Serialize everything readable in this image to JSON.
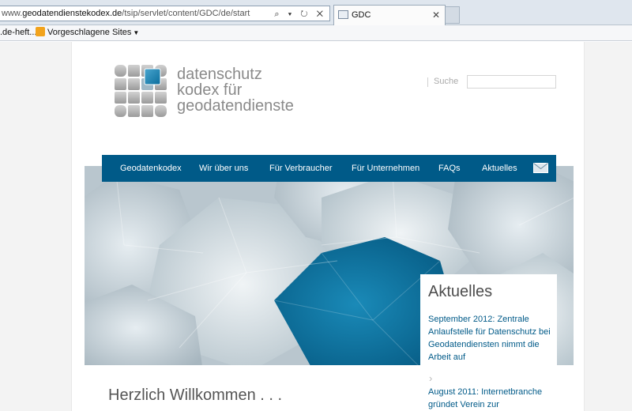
{
  "browser": {
    "url_prefix": "www.",
    "url_domain": "geodatendienstekodex.de",
    "url_path": "/tsip/servlet/content/GDC/de/start",
    "url_icons": "⌕ ▾ ↻ ✕",
    "tab_title": "GDC",
    "tab_close": "✕",
    "favorites": [
      {
        "label": ".de-heft..."
      },
      {
        "label": "Vorgeschlagene Sites",
        "arrow": "▼"
      }
    ]
  },
  "site": {
    "logo_lines": [
      "datenschutz",
      "kodex für",
      "geodatendienste"
    ],
    "search_label": "Suche",
    "search_value": "",
    "nav": [
      "Geodatenkodex",
      "Wir über uns",
      "Für Verbraucher",
      "Für Unternehmen",
      "FAQs",
      "Aktuelles"
    ],
    "mail_icon": "envelope-icon",
    "accent_color": "#005a88",
    "news": {
      "title": "Aktuelles",
      "items": [
        "September 2012: Zentrale Anlaufstelle für Datenschutz bei Geodatendiensten nimmt die Arbeit auf",
        "August 2011: Internetbranche gründet Verein zur"
      ],
      "chevron": "›"
    },
    "welcome": "Herzlich Willkommen . . ."
  }
}
